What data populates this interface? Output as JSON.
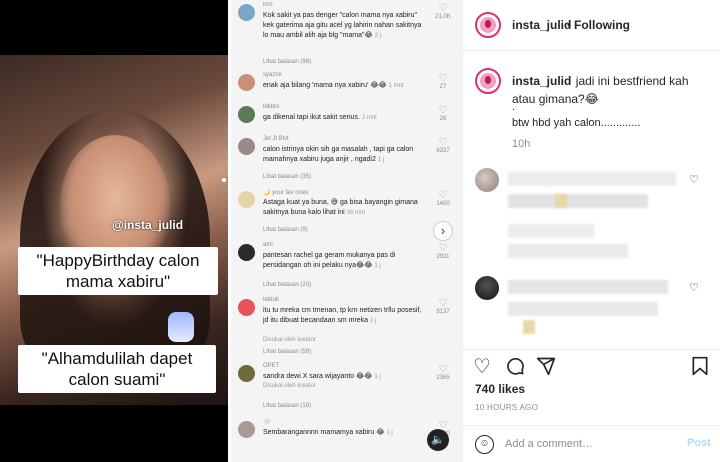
{
  "post": {
    "username": "insta_julid",
    "separator": "•",
    "follow_state": "Following",
    "caption_line1": "jadi ini bestfriend kah atau gimana?😂",
    "caption_line2": ".",
    "caption_line3": "btw hbd yah calon.............",
    "caption_age": "10h",
    "likes": "740 likes",
    "time_ago": "10 HOURS AGO",
    "add_comment_placeholder": "Add a comment…",
    "post_label": "Post"
  },
  "media": {
    "watermark": "@insta_julid",
    "caption1": "\"HappyBirthday calon mama xabiru\"",
    "caption2": "\"Alhamdulilah dapet calon suami\""
  },
  "tiktok_comments_top": [
    {
      "name": "inrs",
      "text": "Kok sakit ya pas denger \"calon mama nya xabiru\" kek gaterima aja gitu acel yg lahirin nahan sakitnya lo mau ambil alih aja blg \"mama\"😂",
      "time": "2 j",
      "count": "21,0K",
      "reply": "Lihat balasan (98)"
    },
    {
      "name": "syaznx",
      "text": "enak aja bilang 'mama nya xabiru' 😂😂",
      "time": "1 mnt",
      "count": "27",
      "reply": ""
    },
    {
      "name": "ldkbro",
      "text": "ga dikenal tapi ikut sakit serius.",
      "time": "2 mnt",
      "count": "26",
      "reply": ""
    },
    {
      "name": "Jel Jt Blvt",
      "text": "calon istrinya okin sih ga masalah , tapi ga calon mamahnya xabiru juga anjir , ngadi2",
      "time": "1 j",
      "count": "6337",
      "reply": "Lihat balasan (35)"
    }
  ],
  "tiktok_comments_bottom": [
    {
      "name": "🌙 your fav ones",
      "text": "Astaga kuat ya buna, 😅 ga bisa bayangin gimana sakitnya buna kalo lihat ini",
      "time": "36 mnt",
      "count": "1400",
      "reply": "Lihat balasan (9)",
      "creator": ""
    },
    {
      "name": "ami",
      "text": "pantesan rachel ga geram mukanya pas di persidangan oh ini pelaku nya😂😂",
      "time": "1 j",
      "count": "2911",
      "reply": "Lihat balasan (20)",
      "creator": ""
    },
    {
      "name": "tektok",
      "text": "itu tu mreka cm tmenan, tp krn netizen trllu posesif, jd itu dibuat becandaan sm mreka",
      "time": "2 j",
      "count": "5137",
      "reply": "Lihat balasan (59)",
      "creator": "Disukai oleh kreator"
    },
    {
      "name": "OPET",
      "text": "sandra dewi X sara wijayanto 😂😂",
      "time": "1 j",
      "count": "2365",
      "reply": "Lihat balasan (18)",
      "creator": "Disukai oleh kreator"
    },
    {
      "name": "🤍",
      "text": "Sembarangannnn mamamya xabiru 😂",
      "time": "1 j",
      "count": "1330",
      "reply": "",
      "creator": ""
    }
  ],
  "icons": {
    "heart": "heart-icon",
    "comment": "comment-icon",
    "share": "share-icon",
    "save": "bookmark-icon",
    "emoji": "emoji-icon",
    "next": "chevron-right-icon",
    "sound": "speaker-icon"
  },
  "colors": {
    "follow_ring": "#e1306c",
    "post_disabled": "#b3dbff",
    "muted_text": "#8e8e8e"
  }
}
